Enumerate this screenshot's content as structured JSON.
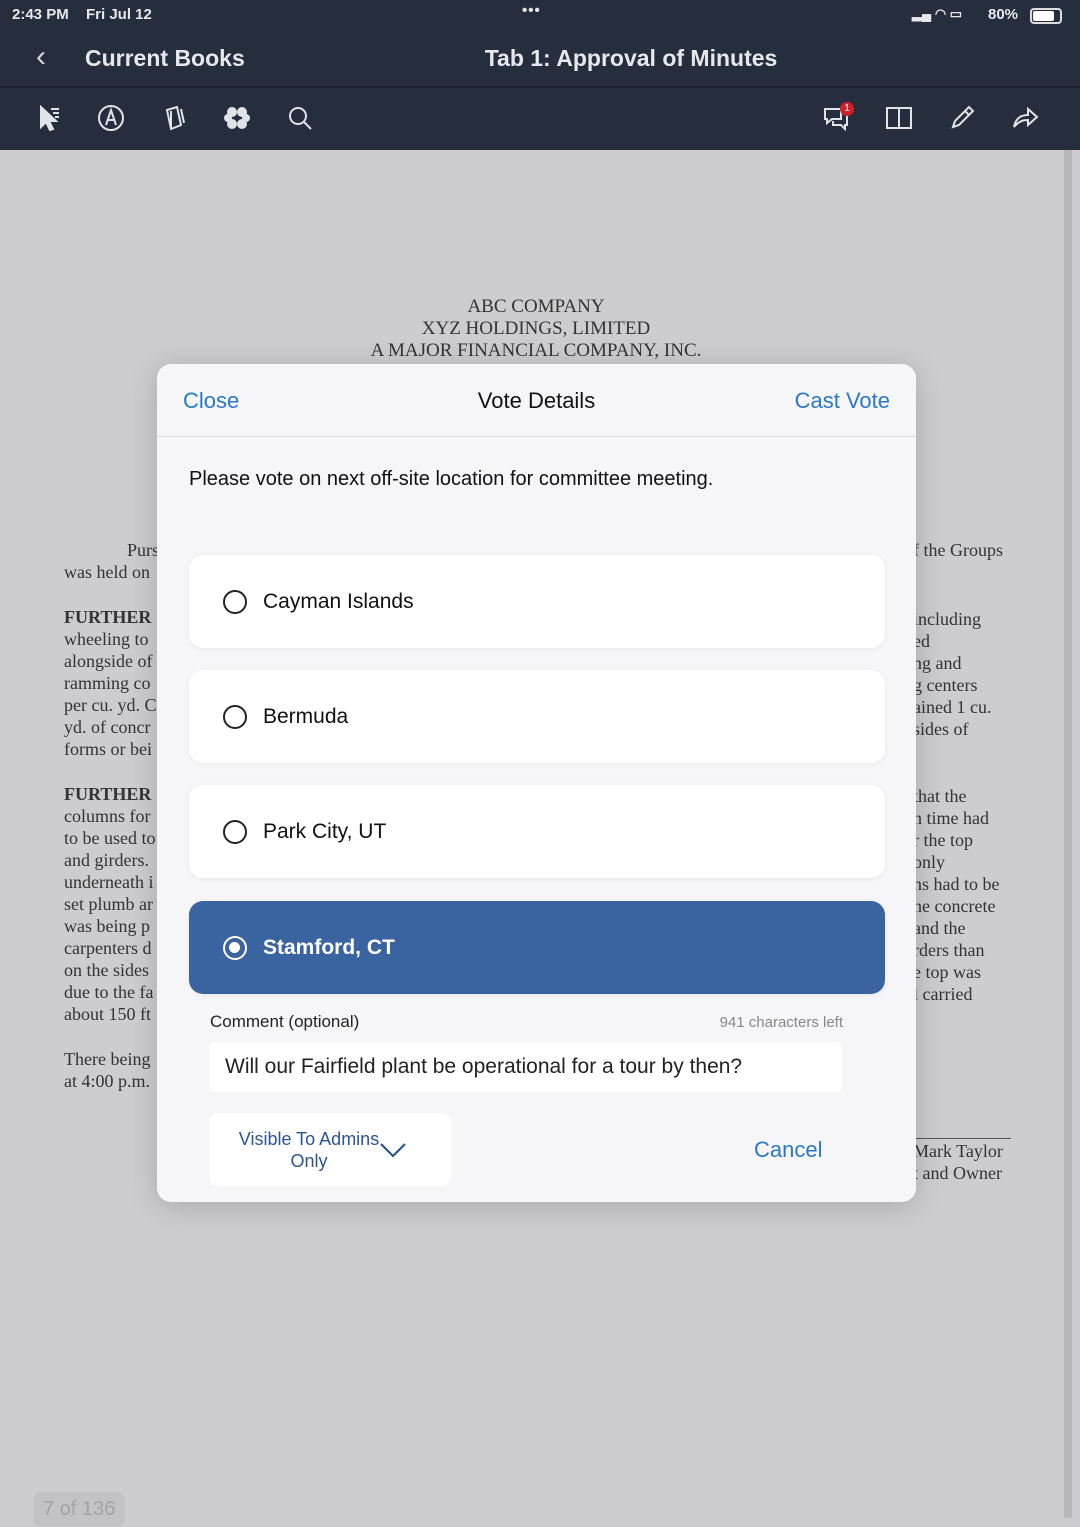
{
  "status": {
    "time": "2:43 PM",
    "date": "Fri Jul 12",
    "battery": "80%"
  },
  "nav": {
    "back_label": "Current Books",
    "title": "Tab 1: Approval of Minutes"
  },
  "toolbar": {
    "left_icons": [
      "select-pointer-icon",
      "pen-circle-icon",
      "copy-pages-icon",
      "flower-icon",
      "search-icon"
    ],
    "right_icons": [
      "comments-icon",
      "book-icon",
      "pencil-icon",
      "share-icon"
    ],
    "comment_badge": "1"
  },
  "document": {
    "header": [
      "ABC COMPANY",
      "XYZ HOLDINGS, LIMITED",
      "A MAJOR FINANCIAL COMPANY, INC."
    ],
    "left_lines": [
      "Purs",
      "was held on",
      "FURTHER",
      "wheeling to",
      "alongside of",
      "ramming co",
      "per cu. yd. C",
      "yd. of concr",
      "forms or bei",
      "FURTHER",
      "columns for",
      "to be used to",
      "and girders.",
      "underneath i",
      "set plumb ar",
      "was being p",
      "carpenters d",
      "on the sides",
      "due to the fa",
      "about 150 ft",
      "There being",
      "at 4:00 p.m."
    ],
    "right_lines": [
      "f the Groups",
      "including",
      "ed",
      "ng and",
      "g centers",
      "ained 1 cu.",
      "sides of",
      "that the",
      "h time had",
      "r the top",
      "only",
      "ns had to be",
      "he concrete",
      "and the",
      "rders than",
      "e top was",
      "l carried",
      "Mark Taylor",
      "t and Owner"
    ],
    "page_indicator": "7 of 136"
  },
  "modal": {
    "close": "Close",
    "title": "Vote Details",
    "cast": "Cast Vote",
    "question": "Please vote on next off-site location for committee meeting.",
    "options": [
      {
        "label": "Cayman Islands",
        "selected": false
      },
      {
        "label": "Bermuda",
        "selected": false
      },
      {
        "label": "Park City, UT",
        "selected": false
      },
      {
        "label": "Stamford, CT",
        "selected": true
      }
    ],
    "comment_label": "Comment (optional)",
    "chars_left": "941 characters left",
    "comment_value": "Will our Fairfield plant be operational for a tour by then?",
    "visibility": "Visible To Admins Only",
    "cancel": "Cancel",
    "selected_color": "#3a64a0",
    "link_color": "#2a78c8"
  }
}
